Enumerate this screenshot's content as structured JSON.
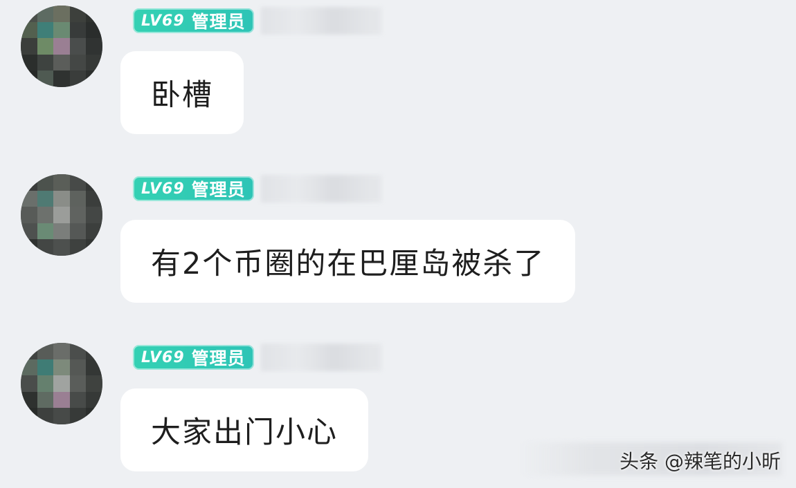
{
  "messages": [
    {
      "level": "LV69",
      "role": "管理员",
      "text": "卧槽"
    },
    {
      "level": "LV69",
      "role": "管理员",
      "text": "有2个币圈的在巴厘岛被杀了"
    },
    {
      "level": "LV69",
      "role": "管理员",
      "text": "大家出门小心"
    }
  ],
  "watermark": "头条 @辣笔的小昕",
  "colors": {
    "background": "#eef0f3",
    "bubble": "#ffffff",
    "badge": "#34d1b3"
  },
  "icons": {
    "avatar": "pixelated-avatar-icon"
  }
}
